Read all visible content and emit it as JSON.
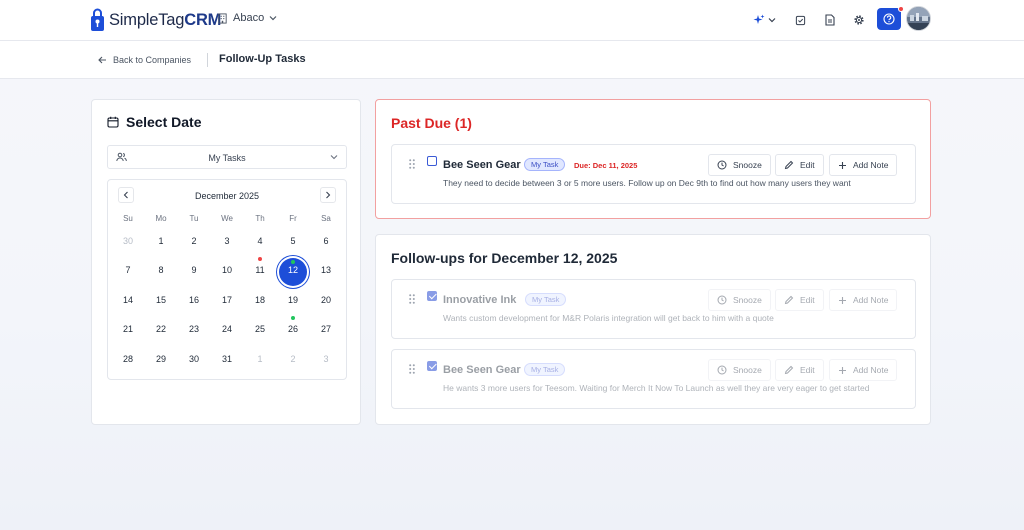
{
  "app": {
    "logo_prefix": "SimpleTag",
    "logo_suffix": "CRM",
    "workspace": "Abaco",
    "colors": {
      "primary": "#1d4ed8",
      "danger": "#dc2626",
      "badge_bg": "#e0e7ff"
    }
  },
  "toolbar": {
    "icons": [
      "sparkle-icon",
      "chevron-down-icon",
      "tasks-icon",
      "document-icon",
      "gear-icon",
      "help-icon",
      "avatar"
    ]
  },
  "subbar": {
    "back_label": "Back to Companies",
    "page_title": "Follow-Up Tasks"
  },
  "date_panel": {
    "title": "Select Date",
    "filter_value": "My Tasks",
    "calendar": {
      "month_label": "December 2025",
      "weekdays": [
        "Su",
        "Mo",
        "Tu",
        "We",
        "Th",
        "Fr",
        "Sa"
      ],
      "weeks": [
        [
          "30",
          "1",
          "2",
          "3",
          "4",
          "5",
          "6"
        ],
        [
          "7",
          "8",
          "9",
          "10",
          "11",
          "12",
          "13"
        ],
        [
          "14",
          "15",
          "16",
          "17",
          "18",
          "19",
          "20"
        ],
        [
          "21",
          "22",
          "23",
          "24",
          "25",
          "26",
          "27"
        ],
        [
          "28",
          "29",
          "30",
          "31",
          "1",
          "2",
          "3"
        ]
      ],
      "selected_day": "12",
      "indicator_days": [
        {
          "day": "11",
          "color": "#ef4444"
        },
        {
          "day": "12",
          "color": "#22c55e"
        },
        {
          "day": "26",
          "color": "#22c55e"
        }
      ]
    }
  },
  "past_due": {
    "title": "Past Due (1)",
    "tasks": [
      {
        "name": "Bee Seen Gear",
        "badge": "My Task",
        "due": "Due: Dec 11, 2025",
        "description": "They need to decide between 3 or 5 more users. Follow up on Dec 9th to find out how many users they want",
        "completed": false
      }
    ]
  },
  "followups": {
    "title": "Follow-ups for December 12, 2025",
    "tasks": [
      {
        "name": "Innovative Ink",
        "badge": "My Task",
        "description": "Wants custom development for M&R Polaris integration will get back to him with a quote",
        "completed": true
      },
      {
        "name": "Bee Seen Gear",
        "badge": "My Task",
        "description": "He wants 3 more users for Teesom. Waiting for Merch It Now To Launch as well they are very eager to get started",
        "completed": true
      }
    ]
  },
  "actions": {
    "snooze": "Snooze",
    "edit": "Edit",
    "add_note": "Add Note"
  }
}
